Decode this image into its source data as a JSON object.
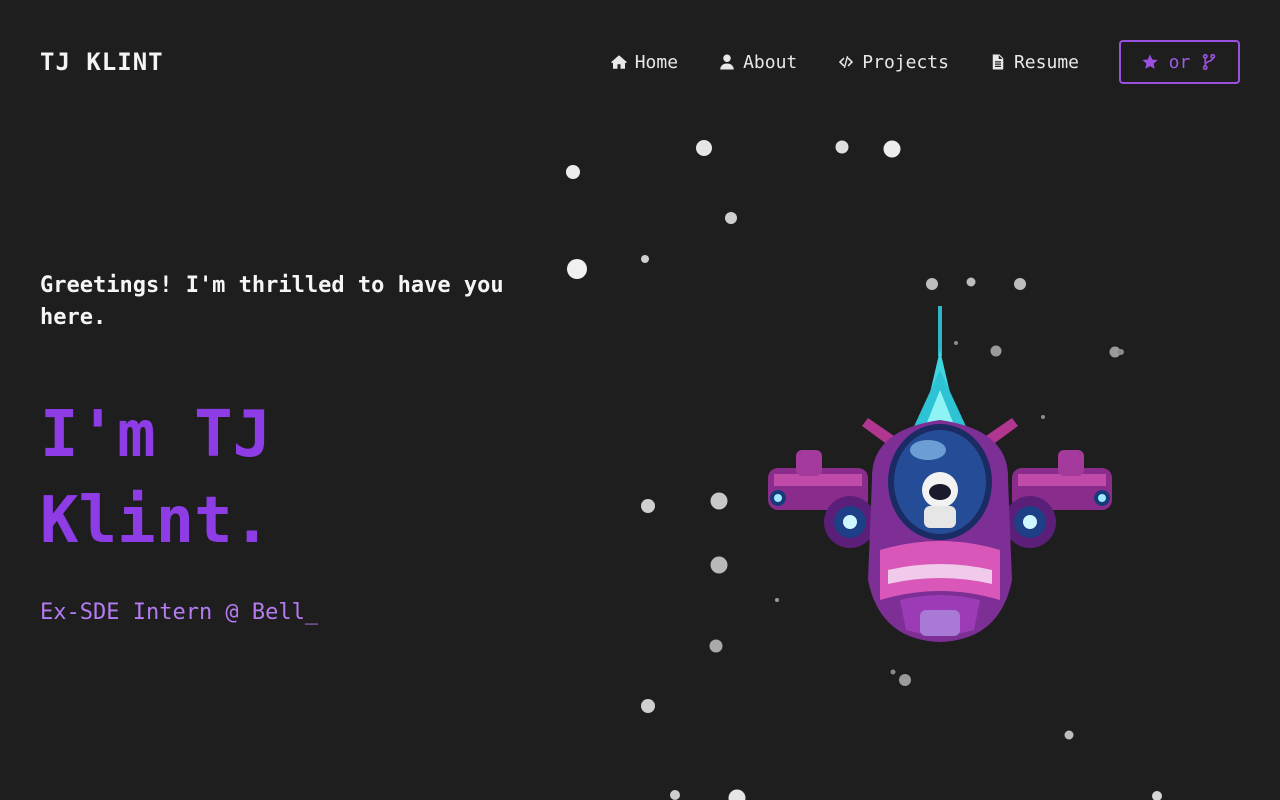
{
  "header": {
    "brand": "TJ KLINT",
    "nav": [
      {
        "label": "Home",
        "icon": "home-icon"
      },
      {
        "label": "About",
        "icon": "user-icon"
      },
      {
        "label": "Projects",
        "icon": "code-icon"
      },
      {
        "label": "Resume",
        "icon": "file-icon"
      }
    ],
    "github_button": {
      "separator": "or",
      "icons": [
        "star-icon",
        "fork-icon"
      ]
    }
  },
  "hero": {
    "greeting": "Greetings! I'm thrilled to have you here.",
    "name": "I'm TJ Klint.",
    "subtitle": "Ex-SDE Intern @ Bell_"
  },
  "colors": {
    "background": "#1e1e1f",
    "accent": "#8e3ce6",
    "accent_light": "#b57bf0",
    "text": "#f2f2f2"
  }
}
